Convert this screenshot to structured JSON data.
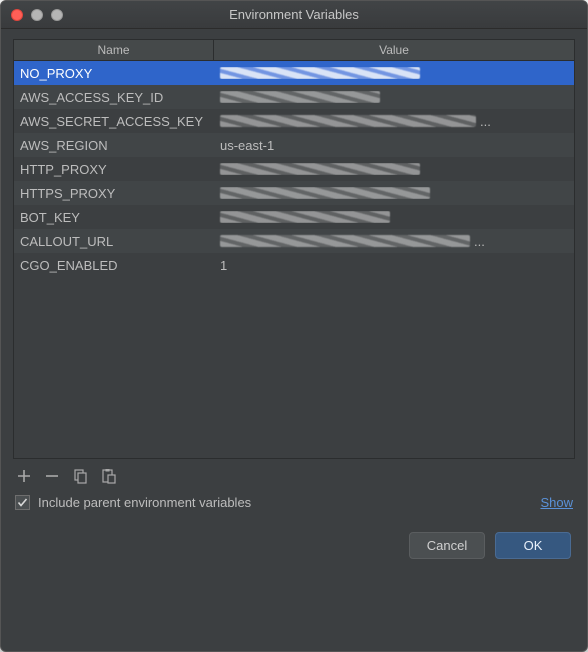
{
  "window": {
    "title": "Environment Variables"
  },
  "table": {
    "headers": {
      "name": "Name",
      "value": "Value"
    },
    "rows": [
      {
        "name": "NO_PROXY",
        "value": "",
        "redacted": true,
        "redactedWidth": 200,
        "selected": true
      },
      {
        "name": "AWS_ACCESS_KEY_ID",
        "value": "",
        "redacted": true,
        "redactedWidth": 160
      },
      {
        "name": "AWS_SECRET_ACCESS_KEY",
        "value": "",
        "redacted": true,
        "redactedWidth": 256,
        "truncated": true
      },
      {
        "name": "AWS_REGION",
        "value": "us-east-1",
        "redacted": false
      },
      {
        "name": "HTTP_PROXY",
        "value": "",
        "redacted": true,
        "redactedWidth": 200
      },
      {
        "name": "HTTPS_PROXY",
        "value": "",
        "redacted": true,
        "redactedWidth": 210
      },
      {
        "name": "BOT_KEY",
        "value": "",
        "redacted": true,
        "redactedWidth": 170
      },
      {
        "name": "CALLOUT_URL",
        "value": "",
        "redacted": true,
        "redactedWidth": 250,
        "truncated": true
      },
      {
        "name": "CGO_ENABLED",
        "value": "1",
        "redacted": false
      }
    ]
  },
  "toolbar": {
    "add_tooltip": "Add",
    "remove_tooltip": "Remove",
    "copy_tooltip": "Copy",
    "paste_tooltip": "Paste"
  },
  "options": {
    "include_parent_label": "Include parent environment variables",
    "include_parent_checked": true,
    "show_link": "Show"
  },
  "buttons": {
    "cancel": "Cancel",
    "ok": "OK"
  }
}
